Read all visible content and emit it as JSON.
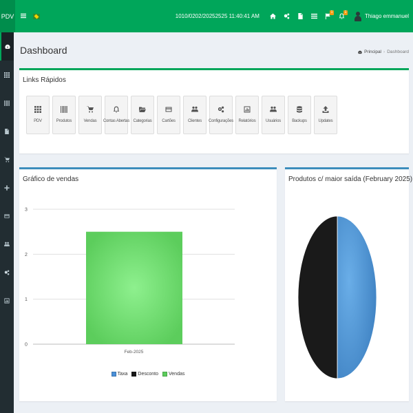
{
  "header": {
    "brand": "PDV",
    "datetime": "1010/0202/20252525 11:40:41 AM",
    "user_name": "Thiago emmanuel",
    "badges": {
      "messages": "1",
      "notifications": "1"
    },
    "icons": [
      "home-icon",
      "cogs-icon",
      "file-icon",
      "list-icon",
      "flag-icon",
      "bell-icon"
    ]
  },
  "sidebar": {
    "items": [
      {
        "icon": "dashboard-icon",
        "active": true
      },
      {
        "icon": "grid-icon"
      },
      {
        "icon": "barcode-icon"
      },
      {
        "icon": "file-icon"
      },
      {
        "icon": "cart-icon"
      },
      {
        "icon": "plus-icon"
      },
      {
        "icon": "card-icon"
      },
      {
        "icon": "users-icon"
      },
      {
        "icon": "cogs-icon"
      },
      {
        "icon": "chart-icon"
      }
    ]
  },
  "page": {
    "title": "Dashboard",
    "breadcrumb": {
      "home": "Principal",
      "current": "Dashboard"
    }
  },
  "quick_links": {
    "title": "Links Rápidos",
    "items": [
      {
        "label": "PDV",
        "icon": "grid-icon"
      },
      {
        "label": "Produtos",
        "icon": "barcode-icon"
      },
      {
        "label": "Vendas",
        "icon": "cart-icon"
      },
      {
        "label": "Contas Abertas",
        "icon": "bell-icon"
      },
      {
        "label": "Categorias",
        "icon": "folder-open-icon"
      },
      {
        "label": "Cartões",
        "icon": "card-icon"
      },
      {
        "label": "Clientes",
        "icon": "users-icon"
      },
      {
        "label": "Configurações",
        "icon": "cogs-icon"
      },
      {
        "label": "Relatórios",
        "icon": "chart-icon"
      },
      {
        "label": "Usuários",
        "icon": "users-icon"
      },
      {
        "label": "Backups",
        "icon": "database-icon"
      },
      {
        "label": "Updates",
        "icon": "upload-icon"
      }
    ]
  },
  "sales_chart": {
    "title": "Gráfico de vendas"
  },
  "products_chart": {
    "title": "Produtos c/ maior saída (February 2025)"
  },
  "chart_data": [
    {
      "type": "bar",
      "categories": [
        "Feb-2025"
      ],
      "series": [
        {
          "name": "Taxa",
          "values": [
            0
          ],
          "color": "#4a90d9"
        },
        {
          "name": "Desconto",
          "values": [
            0
          ],
          "color": "#1a1a1a"
        },
        {
          "name": "Vendas",
          "values": [
            2.5
          ],
          "color": "#5ccd5c"
        }
      ],
      "yticks": [
        "0",
        "1",
        "2",
        "3"
      ],
      "ylim": [
        0,
        3
      ],
      "grid": true,
      "legend": "bottom"
    },
    {
      "type": "pie",
      "slices": [
        {
          "value": 50,
          "color": "#3c7fc0"
        },
        {
          "value": 50,
          "color": "#1a1a1a"
        }
      ]
    }
  ]
}
